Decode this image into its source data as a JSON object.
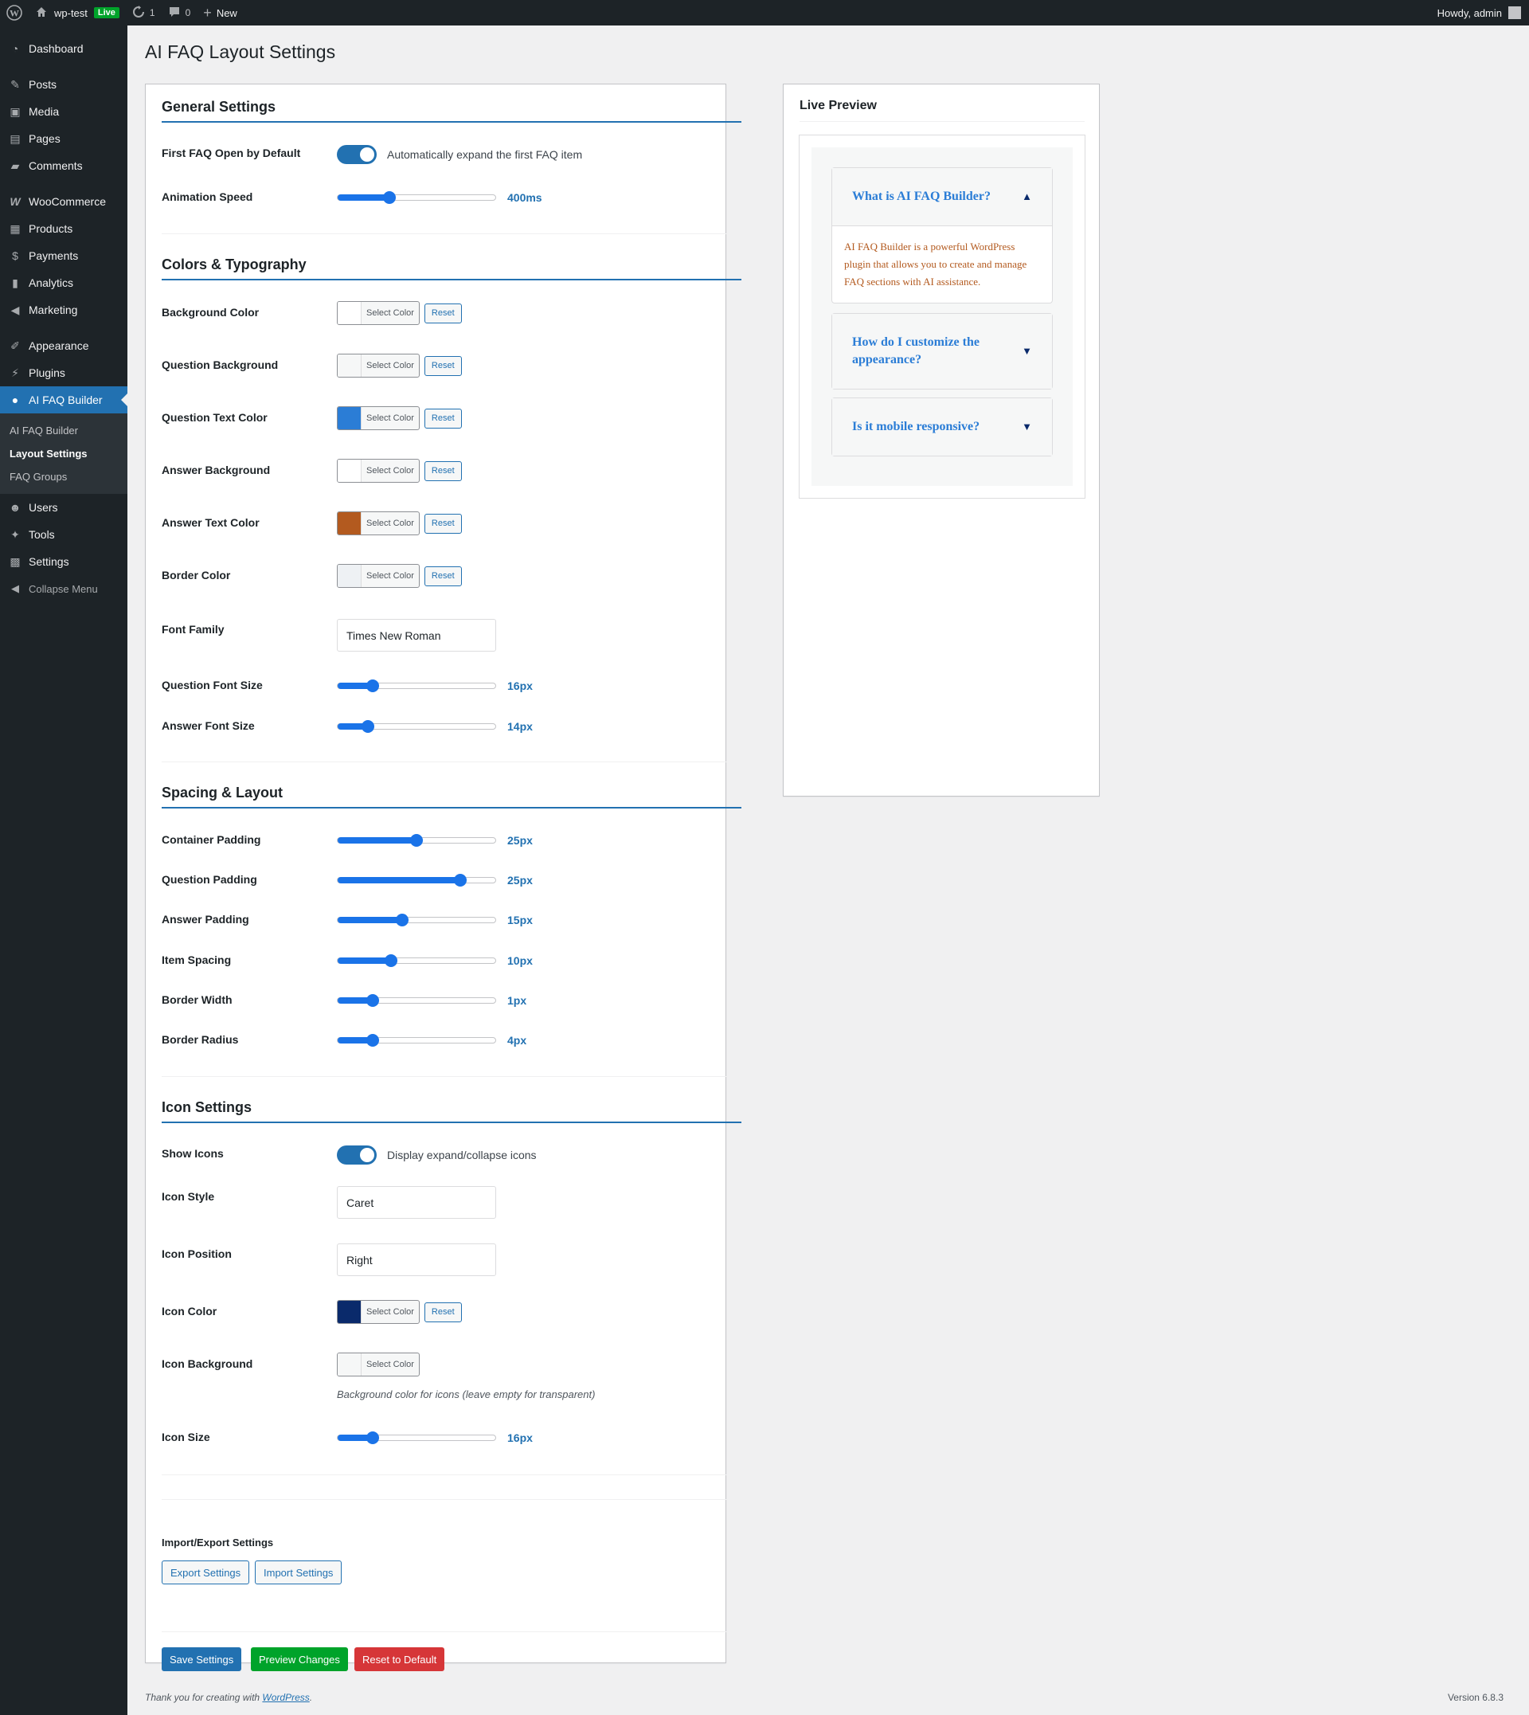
{
  "adminbar": {
    "site_name": "wp-test",
    "live_badge": "Live",
    "updates_count": "1",
    "comments_count": "0",
    "new_label": "New",
    "howdy": "Howdy, admin"
  },
  "sidebar": {
    "items": [
      {
        "label": "Dashboard",
        "icon": "dashboard-icon"
      },
      {
        "label": "Posts",
        "icon": "pin-icon"
      },
      {
        "label": "Media",
        "icon": "media-icon"
      },
      {
        "label": "Pages",
        "icon": "pages-icon"
      },
      {
        "label": "Comments",
        "icon": "comments-icon"
      },
      {
        "label": "WooCommerce",
        "icon": "woocommerce-icon"
      },
      {
        "label": "Products",
        "icon": "products-icon"
      },
      {
        "label": "Payments",
        "icon": "payments-icon"
      },
      {
        "label": "Analytics",
        "icon": "analytics-icon"
      },
      {
        "label": "Marketing",
        "icon": "marketing-icon"
      },
      {
        "label": "Appearance",
        "icon": "appearance-icon"
      },
      {
        "label": "Plugins",
        "icon": "plugins-icon"
      },
      {
        "label": "AI FAQ Builder",
        "icon": "lightbulb-icon"
      },
      {
        "label": "Users",
        "icon": "users-icon"
      },
      {
        "label": "Tools",
        "icon": "tools-icon"
      },
      {
        "label": "Settings",
        "icon": "settings-icon"
      },
      {
        "label": "Collapse Menu",
        "icon": "collapse-icon"
      }
    ],
    "submenu": [
      "AI FAQ Builder",
      "Layout Settings",
      "FAQ Groups"
    ]
  },
  "page": {
    "title": "AI FAQ Layout Settings"
  },
  "general": {
    "title": "General Settings",
    "first_open_label": "First FAQ Open by Default",
    "first_open_desc": "Automatically expand the first FAQ item",
    "first_open_on": true,
    "anim_label": "Animation Speed",
    "anim_value": "400ms",
    "anim_fraction": 0.33
  },
  "colors": {
    "title": "Colors & Typography",
    "select_label": "Select Color",
    "reset_label": "Reset",
    "items": [
      {
        "label": "Background Color",
        "color": "#ffffff"
      },
      {
        "label": "Question Background",
        "color": "#f6f7f7"
      },
      {
        "label": "Question Text Color",
        "color": "#2b7dd6"
      },
      {
        "label": "Answer Background",
        "color": "#ffffff"
      },
      {
        "label": "Answer Text Color",
        "color": "#b35a1f"
      },
      {
        "label": "Border Color",
        "color": "#eef1f4"
      }
    ],
    "font_family_label": "Font Family",
    "font_family_value": "Times New Roman",
    "q_size_label": "Question Font Size",
    "q_size_value": "16px",
    "q_size_fraction": 0.22,
    "a_size_label": "Answer Font Size",
    "a_size_value": "14px",
    "a_size_fraction": 0.19
  },
  "spacing": {
    "title": "Spacing & Layout",
    "items": [
      {
        "label": "Container Padding",
        "value": "25px",
        "fraction": 0.5
      },
      {
        "label": "Question Padding",
        "value": "25px",
        "fraction": 0.78
      },
      {
        "label": "Answer Padding",
        "value": "15px",
        "fraction": 0.41
      },
      {
        "label": "Item Spacing",
        "value": "10px",
        "fraction": 0.34
      },
      {
        "label": "Border Width",
        "value": "1px",
        "fraction": 0.22
      },
      {
        "label": "Border Radius",
        "value": "4px",
        "fraction": 0.22
      }
    ]
  },
  "icons": {
    "title": "Icon Settings",
    "show_label": "Show Icons",
    "show_desc": "Display expand/collapse icons",
    "show_on": true,
    "style_label": "Icon Style",
    "style_value": "Caret",
    "position_label": "Icon Position",
    "position_value": "Right",
    "color_label": "Icon Color",
    "color_value": "#0a2a6b",
    "bg_label": "Icon Background",
    "bg_color": "#f6f7f7",
    "bg_desc": "Background color for icons (leave empty for transparent)",
    "size_label": "Icon Size",
    "size_value": "16px",
    "size_fraction": 0.22
  },
  "io": {
    "title": "Import/Export Settings",
    "export_label": "Export Settings",
    "import_label": "Import Settings"
  },
  "actions": {
    "save_label": "Save Settings",
    "preview_label": "Preview Changes",
    "reset_label": "Reset to Default",
    "save_color": "#2271b1",
    "preview_color": "#00a32a",
    "reset_color": "#d63638"
  },
  "preview": {
    "title": "Live Preview",
    "faqs": [
      {
        "q": "What is AI FAQ Builder?",
        "a": "AI FAQ Builder is a powerful WordPress plugin that allows you to create and manage FAQ sections with AI assistance.",
        "open": true,
        "caret": "▲"
      },
      {
        "q": "How do I customize the appearance?",
        "a": "",
        "open": false,
        "caret": "▼"
      },
      {
        "q": "Is it mobile responsive?",
        "a": "",
        "open": false,
        "caret": "▼"
      }
    ]
  },
  "footer": {
    "thanks": "Thank you for creating with",
    "wp_link": "WordPress",
    "dot": ".",
    "version": "Version 6.8.3"
  }
}
